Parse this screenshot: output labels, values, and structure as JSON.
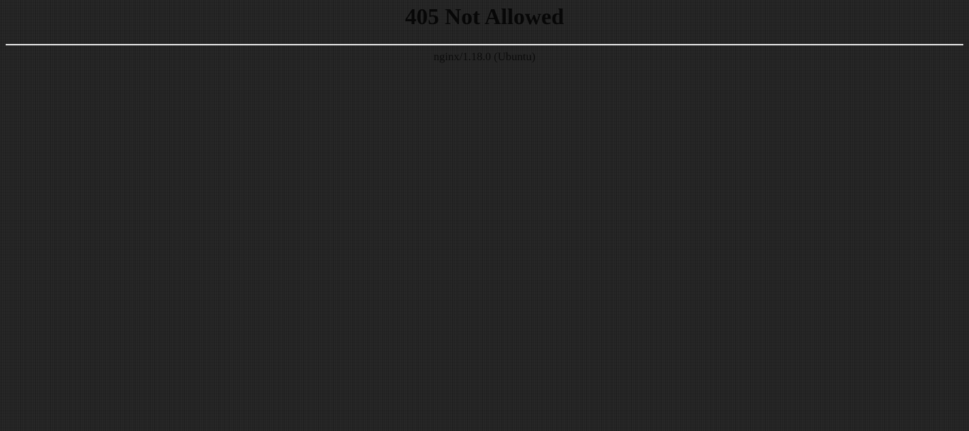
{
  "error": {
    "title": "405 Not Allowed",
    "server": "nginx/1.18.0 (Ubuntu)"
  },
  "colors": {
    "background": "#242424",
    "text": "#0a0a0a",
    "rule": "#e6e6e6"
  }
}
